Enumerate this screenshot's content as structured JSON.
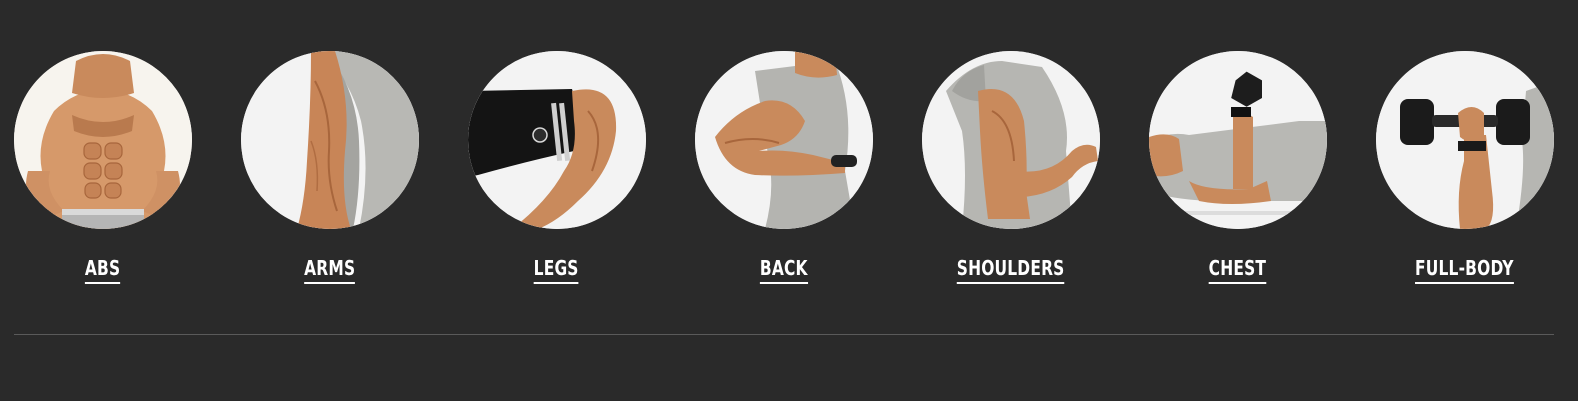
{
  "colors": {
    "background": "#2a2a2a",
    "circle": "#f3f3f3",
    "label": "#ffffff",
    "divider": "#5a5a5a"
  },
  "categories": [
    {
      "label": "ABS",
      "image": "abs-muscle-photo"
    },
    {
      "label": "ARMS",
      "image": "arms-muscle-photo"
    },
    {
      "label": "LEGS",
      "image": "legs-muscle-photo"
    },
    {
      "label": "BACK",
      "image": "back-muscle-photo"
    },
    {
      "label": "SHOULDERS",
      "image": "shoulders-muscle-photo"
    },
    {
      "label": "CHEST",
      "image": "chest-muscle-photo"
    },
    {
      "label": "FULL-BODY",
      "image": "full-body-muscle-photo"
    }
  ]
}
